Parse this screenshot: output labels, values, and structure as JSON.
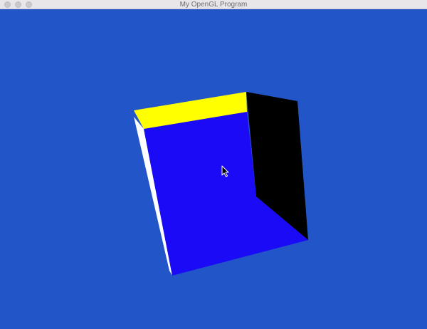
{
  "window": {
    "title": "My OpenGL Program"
  },
  "colors": {
    "background": "#2255c8",
    "titlebar": "#e8e6e8",
    "cube_front_face": "#1a0af5",
    "cube_top_face": "#ffff00",
    "cube_right_face": "#000000",
    "cube_left_face": "#ffffff"
  },
  "cursor": {
    "icon": "arrow-cursor-icon"
  }
}
